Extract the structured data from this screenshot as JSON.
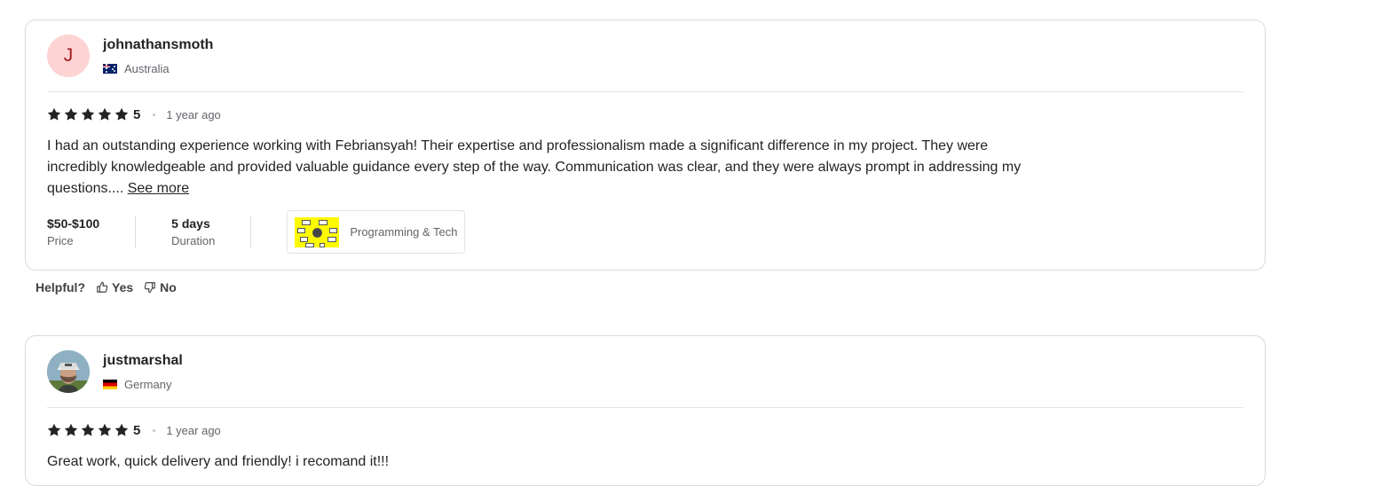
{
  "reviews": [
    {
      "avatar_letter": "J",
      "username": "johnathansmoth",
      "country": "Australia",
      "rating": "5",
      "time_ago": "1 year ago",
      "text": "I had an outstanding experience working with Febriansyah! Their expertise and professionalism made a significant difference in my project. They were incredibly knowledgeable and provided valuable guidance every step of the way. Communication was clear, and they were always prompt in addressing my questions.... ",
      "see_more": "See more",
      "price_value": "$50-$100",
      "price_label": "Price",
      "duration_value": "5 days",
      "duration_label": "Duration",
      "gig_label": "Programming & Tech"
    },
    {
      "username": "justmarshal",
      "country": "Germany",
      "rating": "5",
      "time_ago": "1 year ago",
      "text": "Great work, quick delivery and friendly! i recomand it!!!"
    }
  ],
  "helpful": {
    "label": "Helpful?",
    "yes": "Yes",
    "no": "No"
  },
  "colors": {
    "star": "#222325",
    "avatar_bg": "#fdd3d3",
    "avatar_letter": "#a51f1f",
    "border": "#dadbdd"
  }
}
